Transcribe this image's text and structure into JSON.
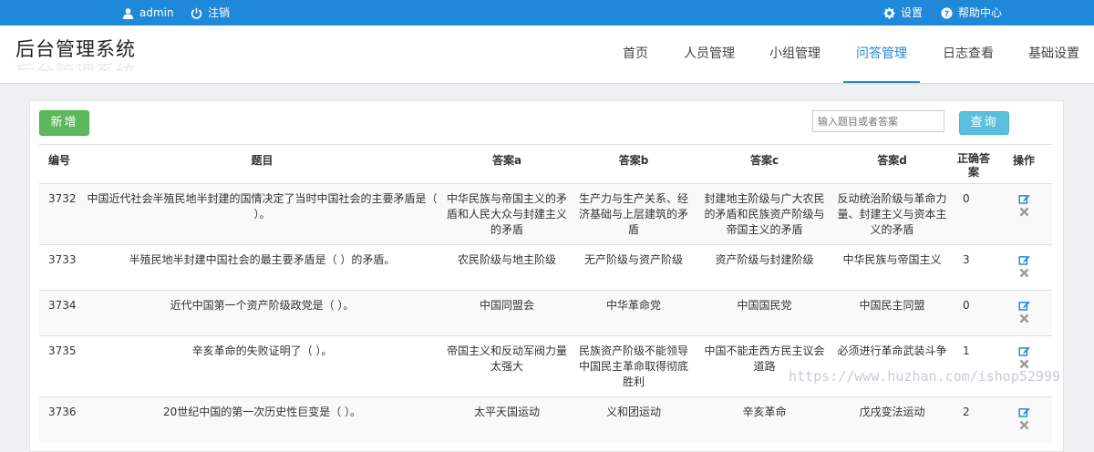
{
  "topbar": {
    "user_label": "admin",
    "logout_label": "注销",
    "settings_label": "设置",
    "help_label": "帮助中心"
  },
  "header": {
    "logo": "后台管理系统",
    "nav": [
      "首页",
      "人员管理",
      "小组管理",
      "问答管理",
      "日志查看",
      "基础设置"
    ],
    "active_nav": "问答管理"
  },
  "toolbar": {
    "add_label": "新增",
    "search_placeholder": "输入题目或者答案",
    "search_label": "查询"
  },
  "table": {
    "headers": {
      "id": "编号",
      "question": "题目",
      "a": "答案a",
      "b": "答案b",
      "c": "答案c",
      "d": "答案d",
      "correct": "正确答案",
      "ops": "操作"
    },
    "rows": [
      {
        "id": "3732",
        "question": "中国近代社会半殖民地半封建的国情决定了当时中国社会的主要矛盾是（ ）。",
        "a": "中华民族与帝国主义的矛盾和人民大众与封建主义的矛盾",
        "b": "生产力与生产关系、经济基础与上层建筑的矛盾",
        "c": "封建地主阶级与广大农民的矛盾和民族资产阶级与帝国主义的矛盾",
        "d": "反动统治阶级与革命力量、封建主义与资本主义的矛盾",
        "correct": "0"
      },
      {
        "id": "3733",
        "question": "半殖民地半封建中国社会的最主要矛盾是（ ）的矛盾。",
        "a": "农民阶级与地主阶级",
        "b": "无产阶级与资产阶级",
        "c": "资产阶级与封建阶级",
        "d": "中华民族与帝国主义",
        "correct": "3"
      },
      {
        "id": "3734",
        "question": "近代中国第一个资产阶级政党是（ ）。",
        "a": "中国同盟会",
        "b": "中华革命党",
        "c": "中国国民党",
        "d": "中国民主同盟",
        "correct": "0"
      },
      {
        "id": "3735",
        "question": "辛亥革命的失败证明了（ ）。",
        "a": "帝国主义和反动军阀力量太强大",
        "b": "民族资产阶级不能领导中国民主革命取得彻底胜利",
        "c": "中国不能走西方民主议会道路",
        "d": "必须进行革命武装斗争",
        "correct": "1"
      },
      {
        "id": "3736",
        "question": "20世纪中国的第一次历史性巨变是（ ）。",
        "a": "太平天国运动",
        "b": "义和团运动",
        "c": "辛亥革命",
        "d": "戊戌变法运动",
        "correct": "2"
      }
    ]
  },
  "watermark": "https://www.huzhan.com/ishop52999",
  "colors": {
    "topbar": "#1f88d8",
    "accent": "#1f88d8",
    "add_button": "#5cb85c",
    "search_button": "#5bc0de"
  },
  "icons": {
    "user": "user-icon",
    "logout": "power-icon",
    "settings": "gear-icon",
    "help": "question-circle-icon",
    "edit": "edit-icon",
    "delete": "close-icon"
  }
}
